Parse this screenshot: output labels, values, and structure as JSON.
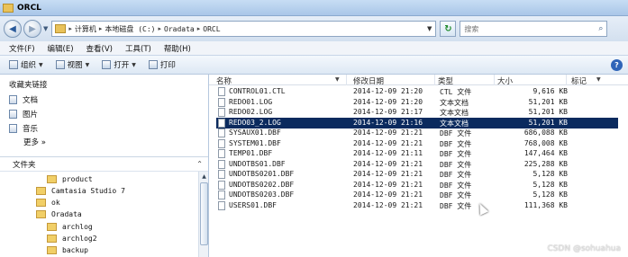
{
  "window": {
    "title": "ORCL"
  },
  "address": {
    "crumbs": [
      "计算机",
      "本地磁盘 (C:)",
      "Oradata",
      "ORCL"
    ],
    "search_placeholder": "搜索"
  },
  "menu": [
    "文件(F)",
    "编辑(E)",
    "查看(V)",
    "工具(T)",
    "帮助(H)"
  ],
  "toolbar": {
    "organize": "组织",
    "view": "视图",
    "open": "打开",
    "print": "打印"
  },
  "favorites": {
    "header": "收藏夹链接",
    "items": [
      "文档",
      "图片",
      "音乐"
    ],
    "more": "更多 »"
  },
  "folders": {
    "header": "文件夹",
    "tree": [
      {
        "label": "product"
      },
      {
        "label": "Camtasia Studio 7"
      },
      {
        "label": "ok"
      },
      {
        "label": "Oradata"
      },
      {
        "label": "archlog"
      },
      {
        "label": "archlog2"
      },
      {
        "label": "backup"
      }
    ]
  },
  "columns": {
    "name": "名称",
    "date": "修改日期",
    "type": "类型",
    "size": "大小",
    "tags": "标记"
  },
  "files": [
    {
      "name": "CONTROL01.CTL",
      "date": "2014-12-09 21:20",
      "type": "CTL 文件",
      "size": "9,616 KB"
    },
    {
      "name": "REDO01.LOG",
      "date": "2014-12-09 21:20",
      "type": "文本文档",
      "size": "51,201 KB"
    },
    {
      "name": "REDO02.LOG",
      "date": "2014-12-09 21:17",
      "type": "文本文档",
      "size": "51,201 KB"
    },
    {
      "name": "REDO03_2.LOG",
      "date": "2014-12-09 21:16",
      "type": "文本文档",
      "size": "51,201 KB",
      "selected": true
    },
    {
      "name": "SYSAUX01.DBF",
      "date": "2014-12-09 21:21",
      "type": "DBF 文件",
      "size": "686,088 KB"
    },
    {
      "name": "SYSTEM01.DBF",
      "date": "2014-12-09 21:21",
      "type": "DBF 文件",
      "size": "768,008 KB"
    },
    {
      "name": "TEMP01.DBF",
      "date": "2014-12-09 21:11",
      "type": "DBF 文件",
      "size": "147,464 KB"
    },
    {
      "name": "UNDOTBS01.DBF",
      "date": "2014-12-09 21:21",
      "type": "DBF 文件",
      "size": "225,288 KB"
    },
    {
      "name": "UNDOTBS0201.DBF",
      "date": "2014-12-09 21:21",
      "type": "DBF 文件",
      "size": "5,128 KB"
    },
    {
      "name": "UNDOTBS0202.DBF",
      "date": "2014-12-09 21:21",
      "type": "DBF 文件",
      "size": "5,128 KB"
    },
    {
      "name": "UNDOTBS0203.DBF",
      "date": "2014-12-09 21:21",
      "type": "DBF 文件",
      "size": "5,128 KB"
    },
    {
      "name": "USERS01.DBF",
      "date": "2014-12-09 21:21",
      "type": "DBF 文件",
      "size": "111,368 KB"
    }
  ],
  "watermark": "CSDN @sohuahua",
  "colors": {
    "selection": "#0a2a5e",
    "folder": "#f1cf67",
    "chrome": "#d3e0ef"
  }
}
